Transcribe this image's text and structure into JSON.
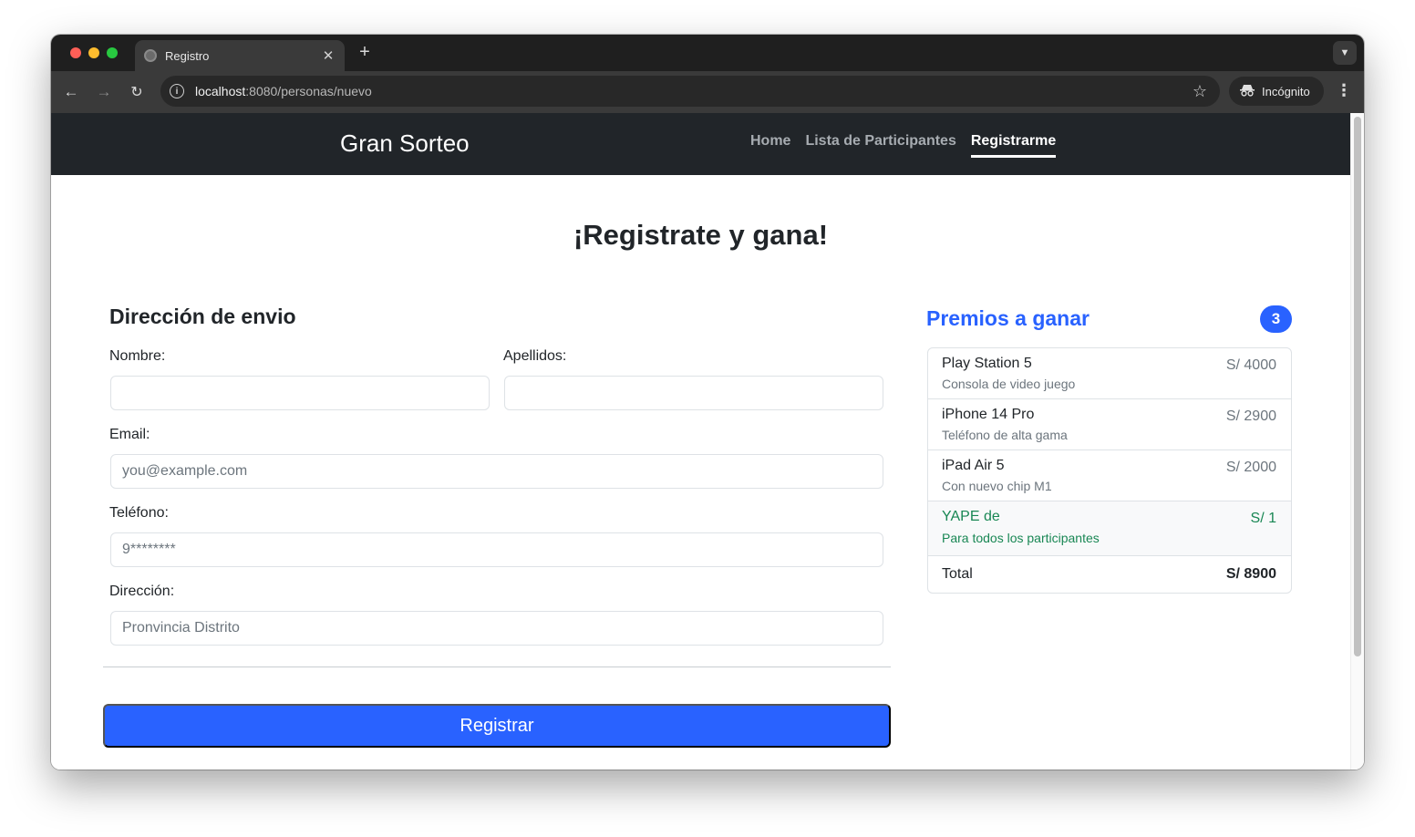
{
  "browser": {
    "tab_title": "Registro",
    "tab_close": "✕",
    "new_tab": "+",
    "url_host": "localhost",
    "url_path": ":8080/personas/nuevo",
    "incognito_label": "Incógnito",
    "icons": {
      "back": "back-arrow-icon",
      "forward": "forward-arrow-icon",
      "reload": "reload-icon",
      "info": "site-info-icon",
      "star": "bookmark-star-icon",
      "incognito": "incognito-icon",
      "menu": "kebab-menu-icon",
      "tab_search": "chevron-down-icon"
    }
  },
  "navbar": {
    "brand": "Gran Sorteo",
    "links": [
      "Home",
      "Lista de Participantes",
      "Registrarme"
    ],
    "active_link": "Registrarme"
  },
  "page": {
    "heading": "¡Registrate y gana!"
  },
  "form": {
    "title": "Dirección de envio",
    "fields": {
      "nombre": {
        "label": "Nombre:",
        "value": "",
        "placeholder": ""
      },
      "apellidos": {
        "label": "Apellidos:",
        "value": "",
        "placeholder": ""
      },
      "email": {
        "label": "Email:",
        "value": "",
        "placeholder": "you@example.com"
      },
      "telefono": {
        "label": "Teléfono:",
        "value": "",
        "placeholder": "9********"
      },
      "direccion": {
        "label": "Dirección:",
        "value": "",
        "placeholder": "Pronvincia Distrito"
      }
    },
    "submit_label": "Registrar"
  },
  "prizes": {
    "title": "Premios a ganar",
    "count": "3",
    "items": [
      {
        "name": "Play Station 5",
        "description": "Consola de video juego",
        "price": "S/ 4000"
      },
      {
        "name": "iPhone 14 Pro",
        "description": "Teléfono de alta gama",
        "price": "S/ 2900"
      },
      {
        "name": "iPad Air 5",
        "description": "Con nuevo chip M1",
        "price": "S/ 2000"
      }
    ],
    "promo": {
      "name": "YAPE de",
      "description": "Para todos los participantes",
      "price": "S/ 1"
    },
    "total": {
      "label": "Total",
      "value": "S/ 8900"
    }
  },
  "colors": {
    "accent": "#2962ff",
    "navbar_bg": "#212529",
    "promo_green": "#198754"
  }
}
